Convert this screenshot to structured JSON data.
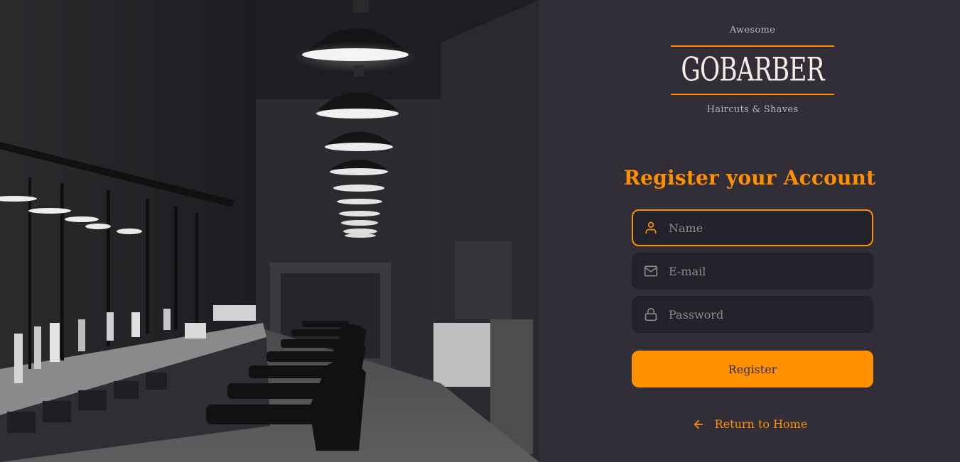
{
  "logo": {
    "top_word": "Awesome",
    "brand": "GOBARBER",
    "bottom_word": "Haircuts & Shaves"
  },
  "form": {
    "title": "Register your Account",
    "fields": {
      "name": {
        "placeholder": "Name",
        "value": "",
        "icon": "user-icon",
        "focused": true
      },
      "email": {
        "placeholder": "E-mail",
        "value": "",
        "icon": "mail-icon"
      },
      "password": {
        "placeholder": "Password",
        "value": "",
        "icon": "lock-icon"
      }
    },
    "submit_label": "Register"
  },
  "back_link": {
    "label": "Return to Home",
    "icon": "arrow-left-icon"
  },
  "colors": {
    "accent": "#ff9000",
    "background": "#312e38",
    "input_background": "#232129",
    "placeholder": "#8d8a92"
  }
}
